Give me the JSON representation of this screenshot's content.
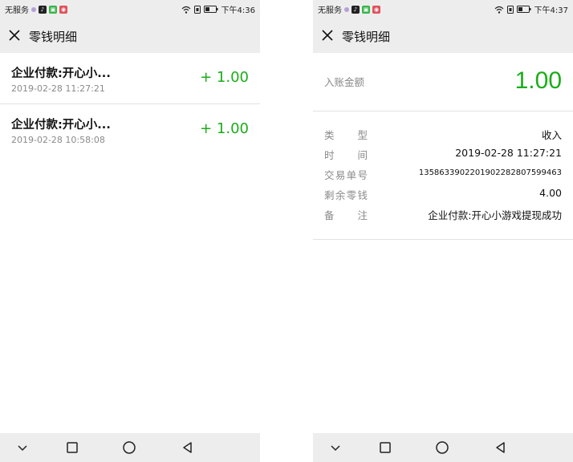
{
  "left": {
    "status_bar": {
      "carrier": "无服务",
      "time": "下午4:36"
    },
    "header": {
      "title": "零钱明细"
    },
    "transactions": [
      {
        "name": "企业付款:开心小...",
        "time": "2019-02-28 11:27:21",
        "amount": "+ 1.00"
      },
      {
        "name": "企业付款:开心小...",
        "time": "2019-02-28 10:58:08",
        "amount": "+ 1.00"
      }
    ]
  },
  "right": {
    "status_bar": {
      "carrier": "无服务",
      "time": "下午4:37"
    },
    "header": {
      "title": "零钱明细"
    },
    "amount_label": "入账金额",
    "amount": "1.00",
    "details": [
      {
        "label_chars": [
          "类",
          "型"
        ],
        "value": "收入"
      },
      {
        "label_chars": [
          "时",
          "间"
        ],
        "value": "2019-02-28 11:27:21"
      },
      {
        "label_chars": [
          "交",
          "易",
          "单",
          "号"
        ],
        "value": "1358633902201902282807599463"
      },
      {
        "label_chars": [
          "剩",
          "余",
          "零",
          "钱"
        ],
        "value": "4.00"
      },
      {
        "label_chars": [
          "备",
          "注"
        ],
        "value": "企业付款:开心小游戏提现成功"
      }
    ]
  },
  "icons": {
    "close": "close-icon",
    "wifi": "wifi-icon",
    "battery": "battery-icon",
    "nav_down": "chevron-down-icon",
    "nav_home": "square-icon",
    "nav_circle": "circle-icon",
    "nav_back": "back-triangle-icon"
  },
  "colors": {
    "accent_green": "#1aad19",
    "header_bg": "#ededed",
    "muted_text": "#8a8a8a",
    "divider": "#e2e2e2"
  }
}
